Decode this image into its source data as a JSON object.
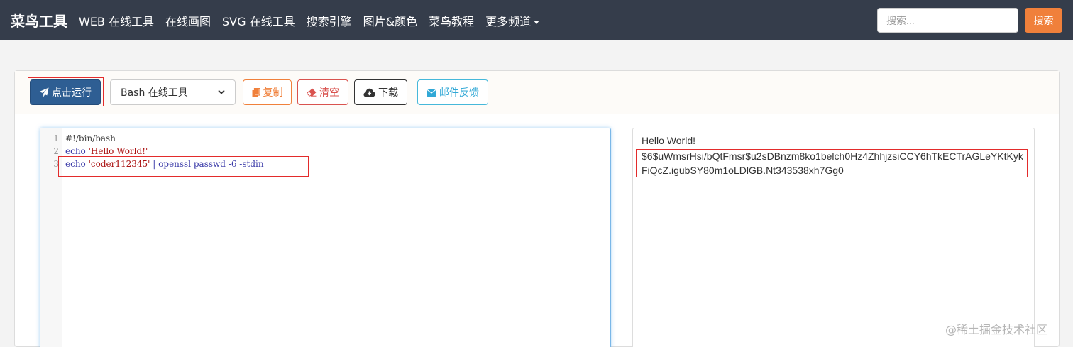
{
  "navbar": {
    "brand": "菜鸟工具",
    "items": [
      {
        "label": "WEB 在线工具"
      },
      {
        "label": "在线画图"
      },
      {
        "label": "SVG 在线工具"
      },
      {
        "label": "搜索引擎"
      },
      {
        "label": "图片&颜色"
      },
      {
        "label": "菜鸟教程"
      },
      {
        "label": "更多频道"
      }
    ],
    "search_placeholder": "搜索...",
    "search_button": "搜索"
  },
  "toolbar": {
    "run_label": "点击运行",
    "language_selected": "Bash 在线工具",
    "copy_label": "复制",
    "clear_label": "清空",
    "download_label": "下载",
    "feedback_label": "邮件反馈"
  },
  "editor": {
    "lines": [
      {
        "number": "1",
        "text": "#!/bin/bash"
      },
      {
        "number": "2",
        "cmd": "echo",
        "str": "'Hello World!'"
      },
      {
        "number": "3",
        "cmd": "echo",
        "str": "'coder112345'",
        "rest": " | openssl passwd -6 -stdin"
      }
    ]
  },
  "output": {
    "lines": [
      "Hello World!",
      "$6$uWmsrHsi/bQtFmsr$u2sDBnzm8ko1belch0Hz4ZhhjzsiCCY6hTkECTrAGLeYKtKyk",
      "FiQcZ.igubSY80m1oLDlGB.Nt343538xh7Gg0"
    ]
  },
  "watermark": "@稀土掘金技术社区",
  "colors": {
    "navbar_bg": "#353d4b",
    "search_button": "#f0803b",
    "run_button": "#2e5e93",
    "highlight_red": "#e32b2b"
  }
}
